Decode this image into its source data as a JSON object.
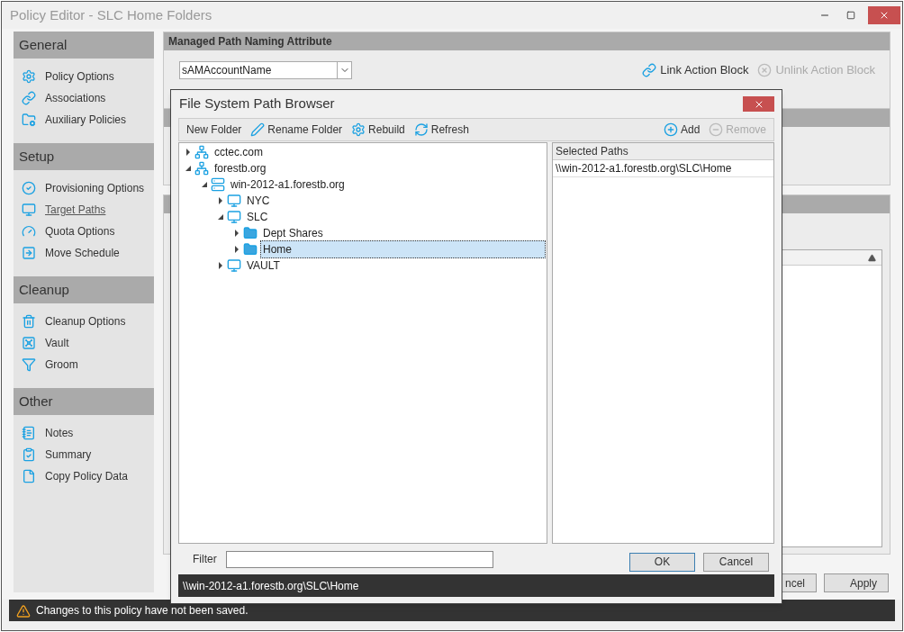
{
  "window": {
    "title": "Policy Editor - SLC Home Folders"
  },
  "sidebar": [
    {
      "title": "General",
      "items": [
        {
          "label": "Policy Options",
          "kind": "gear",
          "selected": false
        },
        {
          "label": "Associations",
          "kind": "link",
          "selected": false
        },
        {
          "label": "Auxiliary Policies",
          "kind": "folder",
          "selected": false
        }
      ]
    },
    {
      "title": "Setup",
      "items": [
        {
          "label": "Provisioning Options",
          "kind": "check",
          "selected": false
        },
        {
          "label": "Target Paths",
          "kind": "monitor",
          "selected": true
        },
        {
          "label": "Quota Options",
          "kind": "gauge",
          "selected": false
        },
        {
          "label": "Move Schedule",
          "kind": "arrow",
          "selected": false
        }
      ]
    },
    {
      "title": "Cleanup",
      "items": [
        {
          "label": "Cleanup Options",
          "kind": "trash",
          "selected": false
        },
        {
          "label": "Vault",
          "kind": "safe",
          "selected": false
        },
        {
          "label": "Groom",
          "kind": "funnel",
          "selected": false
        }
      ]
    },
    {
      "title": "Other",
      "items": [
        {
          "label": "Notes",
          "kind": "notebook",
          "selected": false
        },
        {
          "label": "Summary",
          "kind": "clipboard",
          "selected": false
        },
        {
          "label": "Copy Policy Data",
          "kind": "file",
          "selected": false
        }
      ]
    }
  ],
  "naming_panel": {
    "title": "Managed Path Naming Attribute",
    "attribute": "sAMAccountName",
    "actions": [
      {
        "label": "Link Action Block",
        "kind": "link",
        "disabled": false
      },
      {
        "label": "Unlink Action Block",
        "kind": "unlink",
        "disabled": true
      }
    ]
  },
  "buttons": [
    "ncel",
    "Apply"
  ],
  "status_bar": "Changes to this policy have not been saved.",
  "dialog": {
    "title": "File System Path Browser",
    "toolbar": [
      {
        "label": "New Folder",
        "kind": "none",
        "disabled": false
      },
      {
        "label": "Rename Folder",
        "kind": "pen",
        "disabled": false
      },
      {
        "label": "Rebuild",
        "kind": "gear",
        "disabled": false
      },
      {
        "label": "Refresh",
        "kind": "refresh",
        "disabled": false
      }
    ],
    "toolbar_right": [
      {
        "label": "Add",
        "kind": "plus",
        "disabled": false
      },
      {
        "label": "Remove",
        "kind": "minus",
        "disabled": true
      }
    ],
    "tree": [
      {
        "label": "cctec.com",
        "kind": "domain",
        "expanded": false,
        "selected": false
      },
      {
        "label": "forestb.org",
        "kind": "domain",
        "expanded": true,
        "selected": false,
        "children": [
          {
            "label": "win-2012-a1.forestb.org",
            "kind": "server",
            "expanded": true,
            "selected": false,
            "children": [
              {
                "label": "NYC",
                "kind": "share",
                "expanded": false,
                "selected": false
              },
              {
                "label": "SLC",
                "kind": "share",
                "expanded": true,
                "selected": false,
                "children": [
                  {
                    "label": "Dept Shares",
                    "kind": "folder",
                    "expanded": false,
                    "selected": false
                  },
                  {
                    "label": "Home",
                    "kind": "folder",
                    "expanded": false,
                    "selected": true
                  }
                ]
              },
              {
                "label": "VAULT",
                "kind": "share",
                "expanded": false,
                "selected": false
              }
            ]
          }
        ]
      }
    ],
    "selected_paths": {
      "header": "Selected Paths",
      "rows": [
        "\\\\win-2012-a1.forestb.org\\SLC\\Home"
      ]
    },
    "filter": {
      "label": "Filter"
    },
    "buttons": [
      "OK",
      "Cancel"
    ],
    "path": "\\\\win-2012-a1.forestb.org\\SLC\\Home"
  }
}
